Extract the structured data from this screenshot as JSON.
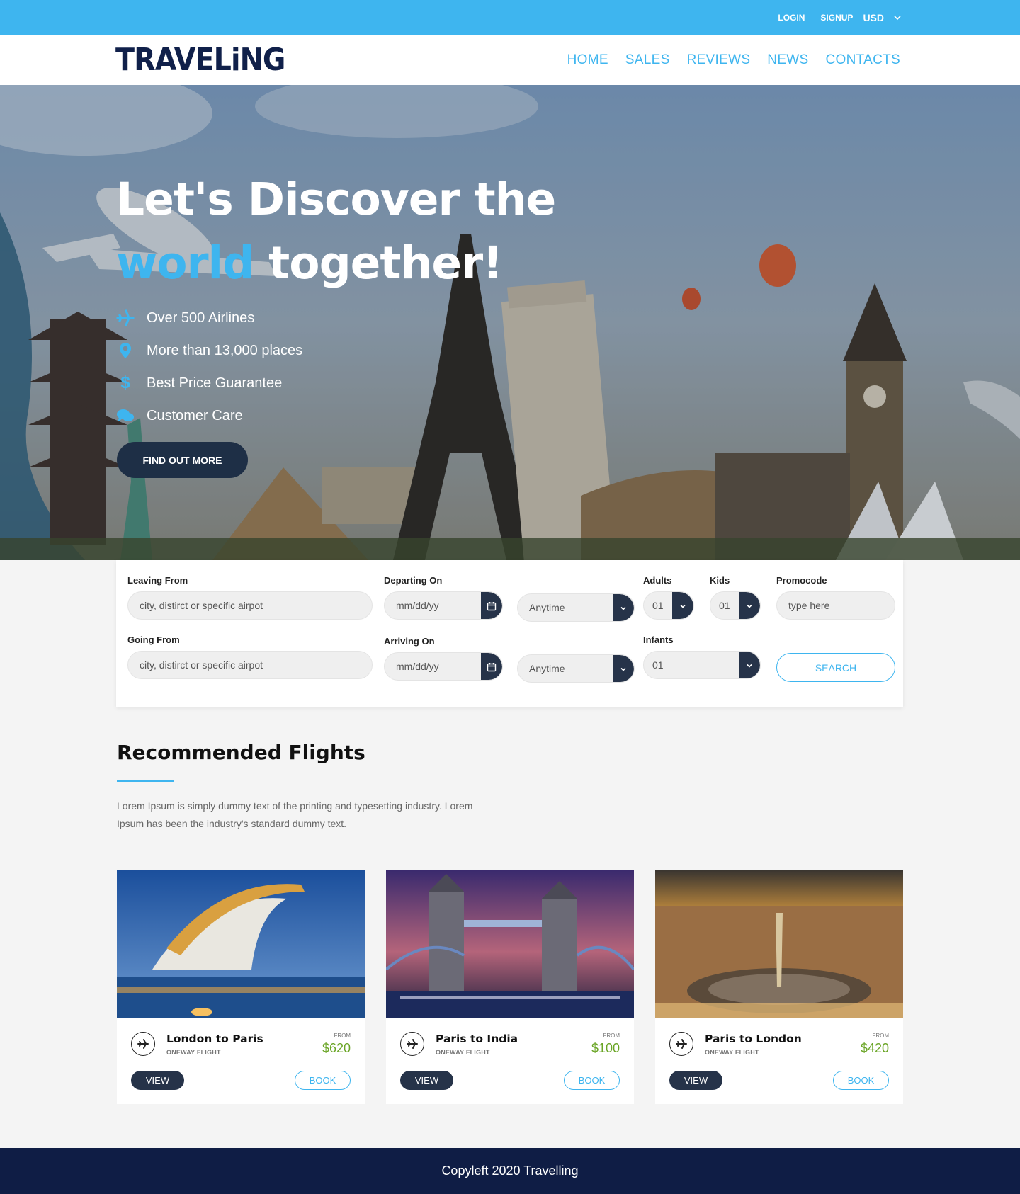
{
  "topbar": {
    "login": "LOGIN",
    "signup": "SIGNUP",
    "currency": "USD"
  },
  "brand": {
    "logo": "TRAVELiNG"
  },
  "nav": [
    "HOME",
    "SALES",
    "REVIEWS",
    "NEWS",
    "CONTACTS"
  ],
  "hero": {
    "title_line1": "Let's Discover the",
    "title_accent": "world",
    "title_rest": " together!",
    "features": [
      {
        "icon": "plane-icon",
        "text": "Over 500 Airlines"
      },
      {
        "icon": "map-pin-icon",
        "text": "More than 13,000 places"
      },
      {
        "icon": "dollar-icon",
        "text": "Best Price Guarantee"
      },
      {
        "icon": "chat-bubbles-icon",
        "text": "Customer Care"
      }
    ],
    "cta": "FIND OUT MORE"
  },
  "search": {
    "leaving_label": "Leaving From",
    "leaving_placeholder": "city, distirct or specific airpot",
    "going_label": "Going From",
    "going_placeholder": "city, distirct or specific airpot",
    "departing_label": "Departing On",
    "departing_value": "mm/dd/yy",
    "departing_time": "Anytime",
    "arriving_label": "Arriving On",
    "arriving_value": "mm/dd/yy",
    "arriving_time": "Anytime",
    "adults_label": "Adults",
    "adults_value": "01",
    "kids_label": "Kids",
    "kids_value": "01",
    "infants_label": "Infants",
    "infants_value": "01",
    "promo_label": "Promocode",
    "promo_placeholder": "type here",
    "button": "SEARCH"
  },
  "recommended": {
    "title": "Recommended Flights",
    "description": "Lorem Ipsum is simply dummy text of the printing and typesetting industry. Lorem Ipsum has been the industry's standard dummy text.",
    "cards": [
      {
        "route": "London to Paris",
        "type": "ONEWAY FLIGHT",
        "from": "FROM",
        "price": "$620",
        "view": "VIEW",
        "book": "BOOK"
      },
      {
        "route": "Paris to India",
        "type": "ONEWAY FLIGHT",
        "from": "FROM",
        "price": "$100",
        "view": "VIEW",
        "book": "BOOK"
      },
      {
        "route": "Paris to London",
        "type": "ONEWAY FLIGHT",
        "from": "FROM",
        "price": "$420",
        "view": "VIEW",
        "book": "BOOK"
      }
    ]
  },
  "footer": {
    "text": "Copyleft 2020 Travelling"
  },
  "colors": {
    "accent": "#3eb5ef",
    "dark": "#263349",
    "footer": "#0f1d45",
    "price": "#6aa526"
  }
}
